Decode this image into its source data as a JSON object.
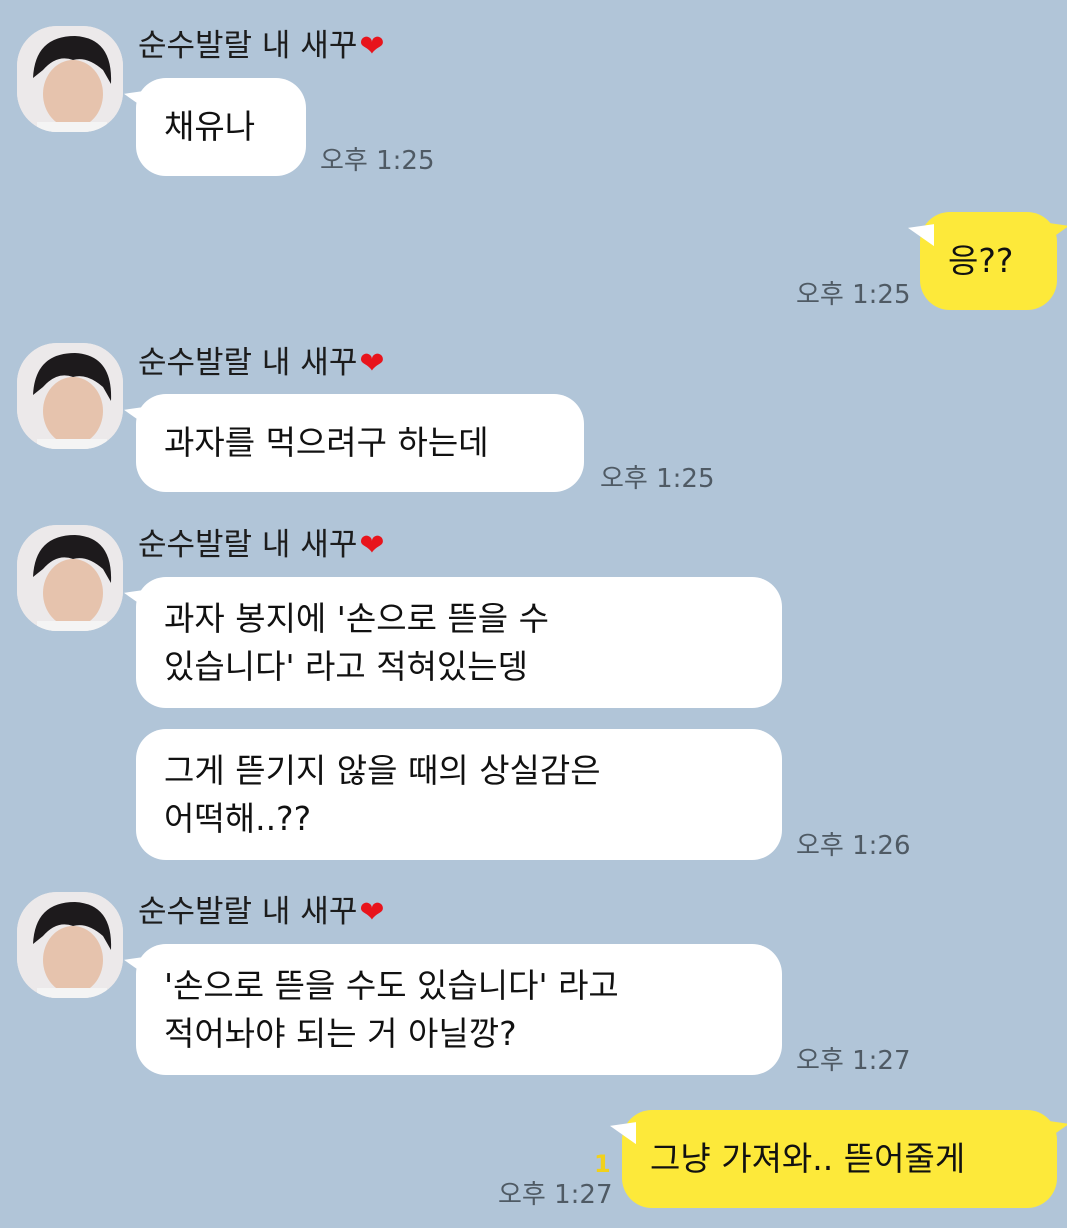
{
  "chat": {
    "messages": [
      {
        "sender": "순수발랄 내 새꾸",
        "sender_emoji": "❤",
        "lines": [
          "채유나"
        ],
        "time": "오후 1:25"
      },
      {
        "from_me": true,
        "lines": [
          "응??"
        ],
        "time": "오후 1:25"
      },
      {
        "sender": "순수발랄 내 새꾸",
        "sender_emoji": "❤",
        "lines": [
          "과자를 먹으려구 하는데"
        ],
        "time": "오후 1:25"
      },
      {
        "sender": "순수발랄 내 새꾸",
        "sender_emoji": "❤",
        "lines": [
          "과자 봉지에 '손으로 뜯을 수",
          "있습니다' 라고 적혀있는뎅"
        ]
      },
      {
        "lines": [
          "그게 뜯기지 않을 때의 상실감은",
          "어떡해..??"
        ],
        "time": "오후 1:26"
      },
      {
        "sender": "순수발랄 내 새꾸",
        "sender_emoji": "❤",
        "lines": [
          "'손으로 뜯을 수도 있습니다' 라고",
          "적어놔야 되는 거 아닐깡?"
        ],
        "time": "오후 1:27"
      },
      {
        "from_me": true,
        "lines": [
          "그냥 가져와.. 뜯어줄게"
        ],
        "time": "오후 1:27",
        "unread": "1"
      }
    ]
  },
  "colors": {
    "background": "#b1c5d8",
    "my_bubble": "#fde93a",
    "their_bubble": "#ffffff",
    "unread": "#f1d11b",
    "heart": "#e8141c"
  },
  "icons": {
    "heart": "heart-emoji",
    "avatar": "profile-photo"
  }
}
